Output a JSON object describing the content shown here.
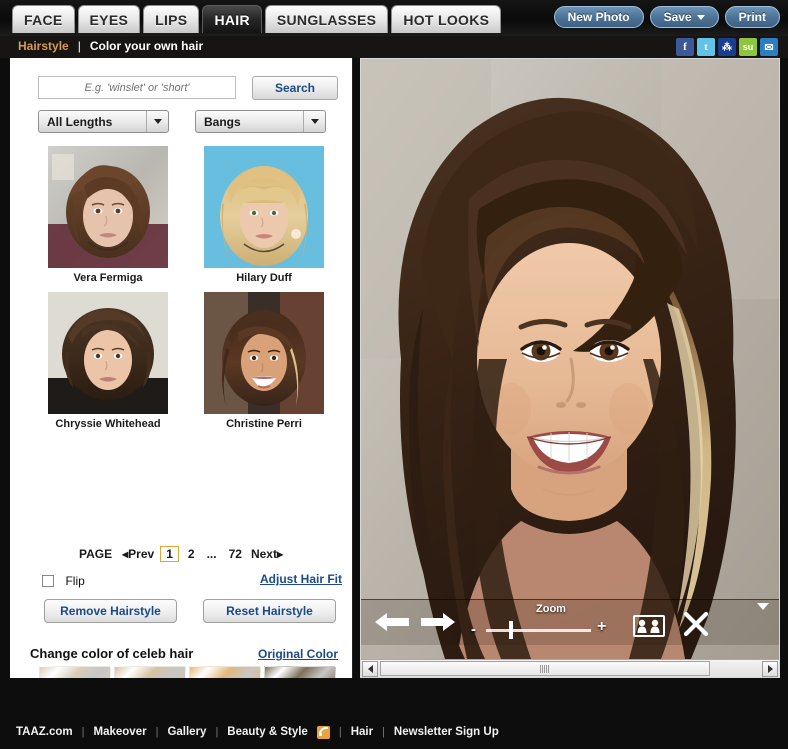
{
  "header": {
    "tabs": [
      {
        "label": "FACE",
        "active": false
      },
      {
        "label": "EYES",
        "active": false
      },
      {
        "label": "LIPS",
        "active": false
      },
      {
        "label": "HAIR",
        "active": true
      },
      {
        "label": "SUNGLASSES",
        "active": false
      },
      {
        "label": "HOT LOOKS",
        "active": false
      }
    ],
    "actions": [
      {
        "label": "New Photo",
        "caret": false
      },
      {
        "label": "Save",
        "caret": true
      },
      {
        "label": "Print",
        "caret": false
      }
    ]
  },
  "subheader": {
    "breadcrumb_1": "Hairstyle",
    "separator": "|",
    "breadcrumb_2": "Color your own hair",
    "accent_color": "#d79a52",
    "social": [
      {
        "name": "facebook-icon",
        "glyph": "f"
      },
      {
        "name": "twitter-icon",
        "glyph": "t"
      },
      {
        "name": "myspace-icon",
        "glyph": "⁂"
      },
      {
        "name": "stumbleupon-icon",
        "glyph": "su"
      },
      {
        "name": "email-icon",
        "glyph": "✉"
      }
    ]
  },
  "sidebar": {
    "search": {
      "placeholder": "E.g. 'winslet' or 'short'",
      "value": "",
      "button_label": "Search"
    },
    "filters": [
      {
        "name": "length-select",
        "value": "All Lengths"
      },
      {
        "name": "bangs-select",
        "value": "Bangs"
      }
    ],
    "thumbnails": [
      {
        "name": "Vera Fermiga"
      },
      {
        "name": "Hilary Duff"
      },
      {
        "name": "Chryssie Whitehead"
      },
      {
        "name": "Christine Perri"
      }
    ],
    "pagination": {
      "label": "PAGE",
      "prev": "◂Prev",
      "pages": [
        "1",
        "2",
        "...",
        "72"
      ],
      "current": "1",
      "next": "Next▸"
    },
    "flip": {
      "label": "Flip",
      "checked": false
    },
    "adjust_link": "Adjust Hair Fit",
    "buttons": [
      {
        "label": "Remove Hairstyle"
      },
      {
        "label": "Reset Hairstyle"
      }
    ],
    "color_section": {
      "title": "Change color of celeb hair",
      "original_link": "Original Color",
      "swatches": [
        "#d8cdb8",
        "#d6c3a2",
        "#e3b87b",
        "#7e7058",
        "#6b4a32",
        "#a44a22",
        "#4a3224",
        "#7d3526"
      ],
      "arrow_color": "#4ec4ba"
    }
  },
  "viewer": {
    "toolbar": {
      "back": "back-arrow",
      "forward": "forward-arrow",
      "zoom_label": "Zoom",
      "zoom_minus": "-",
      "zoom_plus": "+",
      "compare": "compare-faces",
      "close": "close"
    }
  },
  "footer": {
    "links": [
      "TAAZ.com",
      "Makeover",
      "Gallery",
      "Beauty & Style",
      "Hair",
      "Newsletter Sign Up"
    ],
    "separator": "|"
  }
}
